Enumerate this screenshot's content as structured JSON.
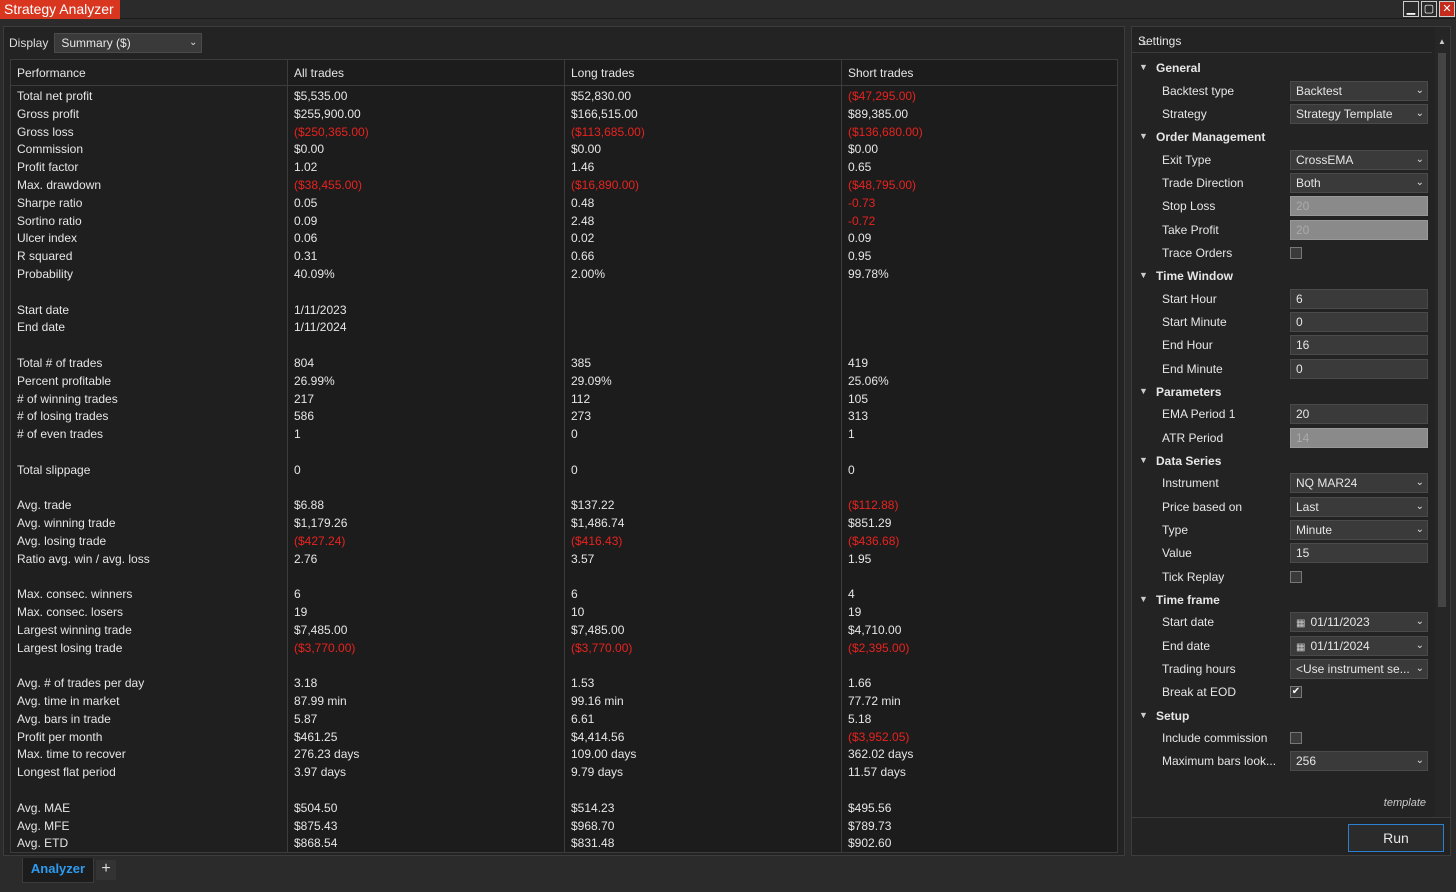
{
  "window": {
    "title": "Strategy Analyzer"
  },
  "display": {
    "label": "Display",
    "value": "Summary ($)"
  },
  "table": {
    "headers": [
      "Performance",
      "All trades",
      "Long trades",
      "Short trades"
    ],
    "rows": [
      [
        "Total net profit",
        "$5,535.00",
        "$52,830.00",
        "($47,295.00)"
      ],
      [
        "Gross profit",
        "$255,900.00",
        "$166,515.00",
        "$89,385.00"
      ],
      [
        "Gross loss",
        "($250,365.00)",
        "($113,685.00)",
        "($136,680.00)"
      ],
      [
        "Commission",
        "$0.00",
        "$0.00",
        "$0.00"
      ],
      [
        "Profit factor",
        "1.02",
        "1.46",
        "0.65"
      ],
      [
        "Max. drawdown",
        "($38,455.00)",
        "($16,890.00)",
        "($48,795.00)"
      ],
      [
        "Sharpe ratio",
        "0.05",
        "0.48",
        "-0.73"
      ],
      [
        "Sortino ratio",
        "0.09",
        "2.48",
        "-0.72"
      ],
      [
        "Ulcer index",
        "0.06",
        "0.02",
        "0.09"
      ],
      [
        "R squared",
        "0.31",
        "0.66",
        "0.95"
      ],
      [
        "Probability",
        "40.09%",
        "2.00%",
        "99.78%"
      ],
      [
        "",
        "",
        "",
        ""
      ],
      [
        "Start date",
        "1/11/2023",
        "",
        ""
      ],
      [
        "End date",
        "1/11/2024",
        "",
        ""
      ],
      [
        "",
        "",
        "",
        ""
      ],
      [
        "Total # of trades",
        "804",
        "385",
        "419"
      ],
      [
        "Percent profitable",
        "26.99%",
        "29.09%",
        "25.06%"
      ],
      [
        "# of winning trades",
        "217",
        "112",
        "105"
      ],
      [
        "# of losing trades",
        "586",
        "273",
        "313"
      ],
      [
        "# of even trades",
        "1",
        "0",
        "1"
      ],
      [
        "",
        "",
        "",
        ""
      ],
      [
        "Total slippage",
        "0",
        "0",
        "0"
      ],
      [
        "",
        "",
        "",
        ""
      ],
      [
        "Avg. trade",
        "$6.88",
        "$137.22",
        "($112.88)"
      ],
      [
        "Avg. winning trade",
        "$1,179.26",
        "$1,486.74",
        "$851.29"
      ],
      [
        "Avg. losing trade",
        "($427.24)",
        "($416.43)",
        "($436.68)"
      ],
      [
        "Ratio avg. win / avg. loss",
        "2.76",
        "3.57",
        "1.95"
      ],
      [
        "",
        "",
        "",
        ""
      ],
      [
        "Max. consec. winners",
        "6",
        "6",
        "4"
      ],
      [
        "Max. consec. losers",
        "19",
        "10",
        "19"
      ],
      [
        "Largest winning trade",
        "$7,485.00",
        "$7,485.00",
        "$4,710.00"
      ],
      [
        "Largest losing trade",
        "($3,770.00)",
        "($3,770.00)",
        "($2,395.00)"
      ],
      [
        "",
        "",
        "",
        ""
      ],
      [
        "Avg. # of trades per day",
        "3.18",
        "1.53",
        "1.66"
      ],
      [
        "Avg. time in market",
        "87.99 min",
        "99.16 min",
        "77.72 min"
      ],
      [
        "Avg. bars in trade",
        "5.87",
        "6.61",
        "5.18"
      ],
      [
        "Profit per month",
        "$461.25",
        "$4,414.56",
        "($3,952.05)"
      ],
      [
        "Max. time to recover",
        "276.23 days",
        "109.00 days",
        "362.02 days"
      ],
      [
        "Longest flat period",
        "3.97 days",
        "9.79 days",
        "11.57 days"
      ],
      [
        "",
        "",
        "",
        ""
      ],
      [
        "Avg. MAE",
        "$504.50",
        "$514.23",
        "$495.56"
      ],
      [
        "Avg. MFE",
        "$875.43",
        "$968.70",
        "$789.73"
      ],
      [
        "Avg. ETD",
        "$868.54",
        "$831.48",
        "$902.60"
      ]
    ]
  },
  "settings": {
    "title": "Settings",
    "template_label": "template",
    "run_label": "Run",
    "items": [
      {
        "kind": "category",
        "label": "General"
      },
      {
        "kind": "select",
        "label": "Backtest type",
        "value": "Backtest"
      },
      {
        "kind": "select",
        "label": "Strategy",
        "value": "Strategy Template"
      },
      {
        "kind": "category",
        "label": "Order Management"
      },
      {
        "kind": "select",
        "label": "Exit Type",
        "value": "CrossEMA"
      },
      {
        "kind": "select",
        "label": "Trade Direction",
        "value": "Both"
      },
      {
        "kind": "disabled",
        "label": "Stop Loss",
        "value": "20"
      },
      {
        "kind": "disabled",
        "label": "Take Profit",
        "value": "20"
      },
      {
        "kind": "check",
        "label": "Trace Orders",
        "value": ""
      },
      {
        "kind": "category",
        "label": "Time Window"
      },
      {
        "kind": "text",
        "label": "Start Hour",
        "value": "6"
      },
      {
        "kind": "text",
        "label": "Start Minute",
        "value": "0"
      },
      {
        "kind": "text",
        "label": "End Hour",
        "value": "16"
      },
      {
        "kind": "text",
        "label": "End Minute",
        "value": "0"
      },
      {
        "kind": "category",
        "label": "Parameters"
      },
      {
        "kind": "text",
        "label": "EMA Period 1",
        "value": "20"
      },
      {
        "kind": "disabled",
        "label": "ATR Period",
        "value": "14"
      },
      {
        "kind": "category",
        "label": "Data Series"
      },
      {
        "kind": "select",
        "label": "Instrument",
        "value": "NQ MAR24"
      },
      {
        "kind": "select",
        "label": "Price based on",
        "value": "Last"
      },
      {
        "kind": "select",
        "label": "Type",
        "value": "Minute"
      },
      {
        "kind": "text",
        "label": "Value",
        "value": "15"
      },
      {
        "kind": "check",
        "label": "Tick Replay",
        "value": ""
      },
      {
        "kind": "category",
        "label": "Time frame"
      },
      {
        "kind": "date",
        "label": "Start date",
        "value": "01/11/2023"
      },
      {
        "kind": "date",
        "label": "End date",
        "value": "01/11/2024"
      },
      {
        "kind": "select",
        "label": "Trading hours",
        "value": "<Use instrument se..."
      },
      {
        "kind": "check",
        "label": "Break at EOD",
        "value": "✔"
      },
      {
        "kind": "category",
        "label": "Setup"
      },
      {
        "kind": "check",
        "label": "Include commission",
        "value": ""
      },
      {
        "kind": "select",
        "label": "Maximum bars look...",
        "value": "256"
      }
    ]
  },
  "tabs": [
    {
      "label": "Analyzer"
    }
  ],
  "colors": {
    "negative": "#e8231f",
    "accent": "#2d9bf0",
    "title_bg": "#d9361f"
  }
}
